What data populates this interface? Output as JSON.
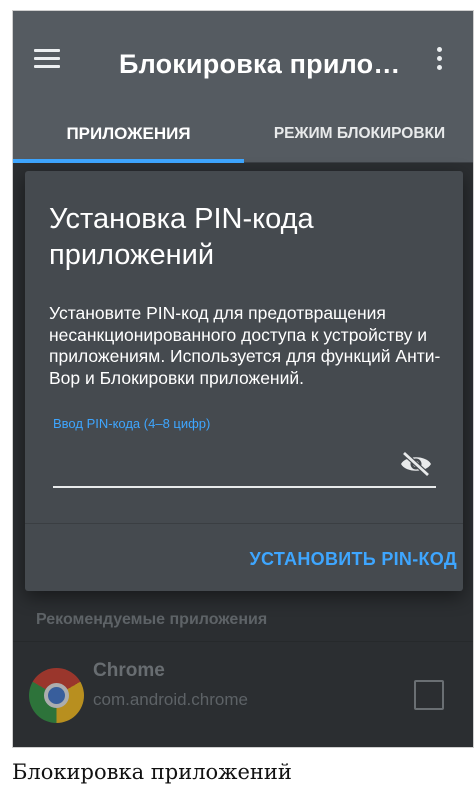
{
  "toolbar": {
    "title": "Блокировка прило…",
    "menu_icon": "hamburger-menu-icon",
    "more_icon": "more-vertical-icon"
  },
  "tabs": [
    {
      "label": "ПРИЛОЖЕНИЯ",
      "active": true
    },
    {
      "label": "РЕЖИМ БЛОКИРОВКИ",
      "active": false
    }
  ],
  "dialog": {
    "title": "Установка PIN-кода приложений",
    "body": "Установите PIN-код для предотвращения несанкционированного доступа к устройству и приложениям. Используется для функций Анти-Вор и Блокировки приложений.",
    "field_label": "Ввод PIN-кода (4–8 цифр)",
    "field_value": "",
    "visibility_icon": "visibility-off-icon",
    "action_label": "УСТАНОВИТЬ PIN-КОД"
  },
  "list": {
    "section_label": "Рекомендуемые приложения",
    "apps": [
      {
        "name": "Chrome",
        "package": "com.android.chrome",
        "icon": "chrome-icon",
        "checked": false
      }
    ]
  },
  "caption": "Блокировка приложений",
  "colors": {
    "toolbar": "#555b61",
    "accent": "#3ea6ff",
    "dialog_bg": "#454a4f",
    "content_bg": "#2b2e31"
  }
}
